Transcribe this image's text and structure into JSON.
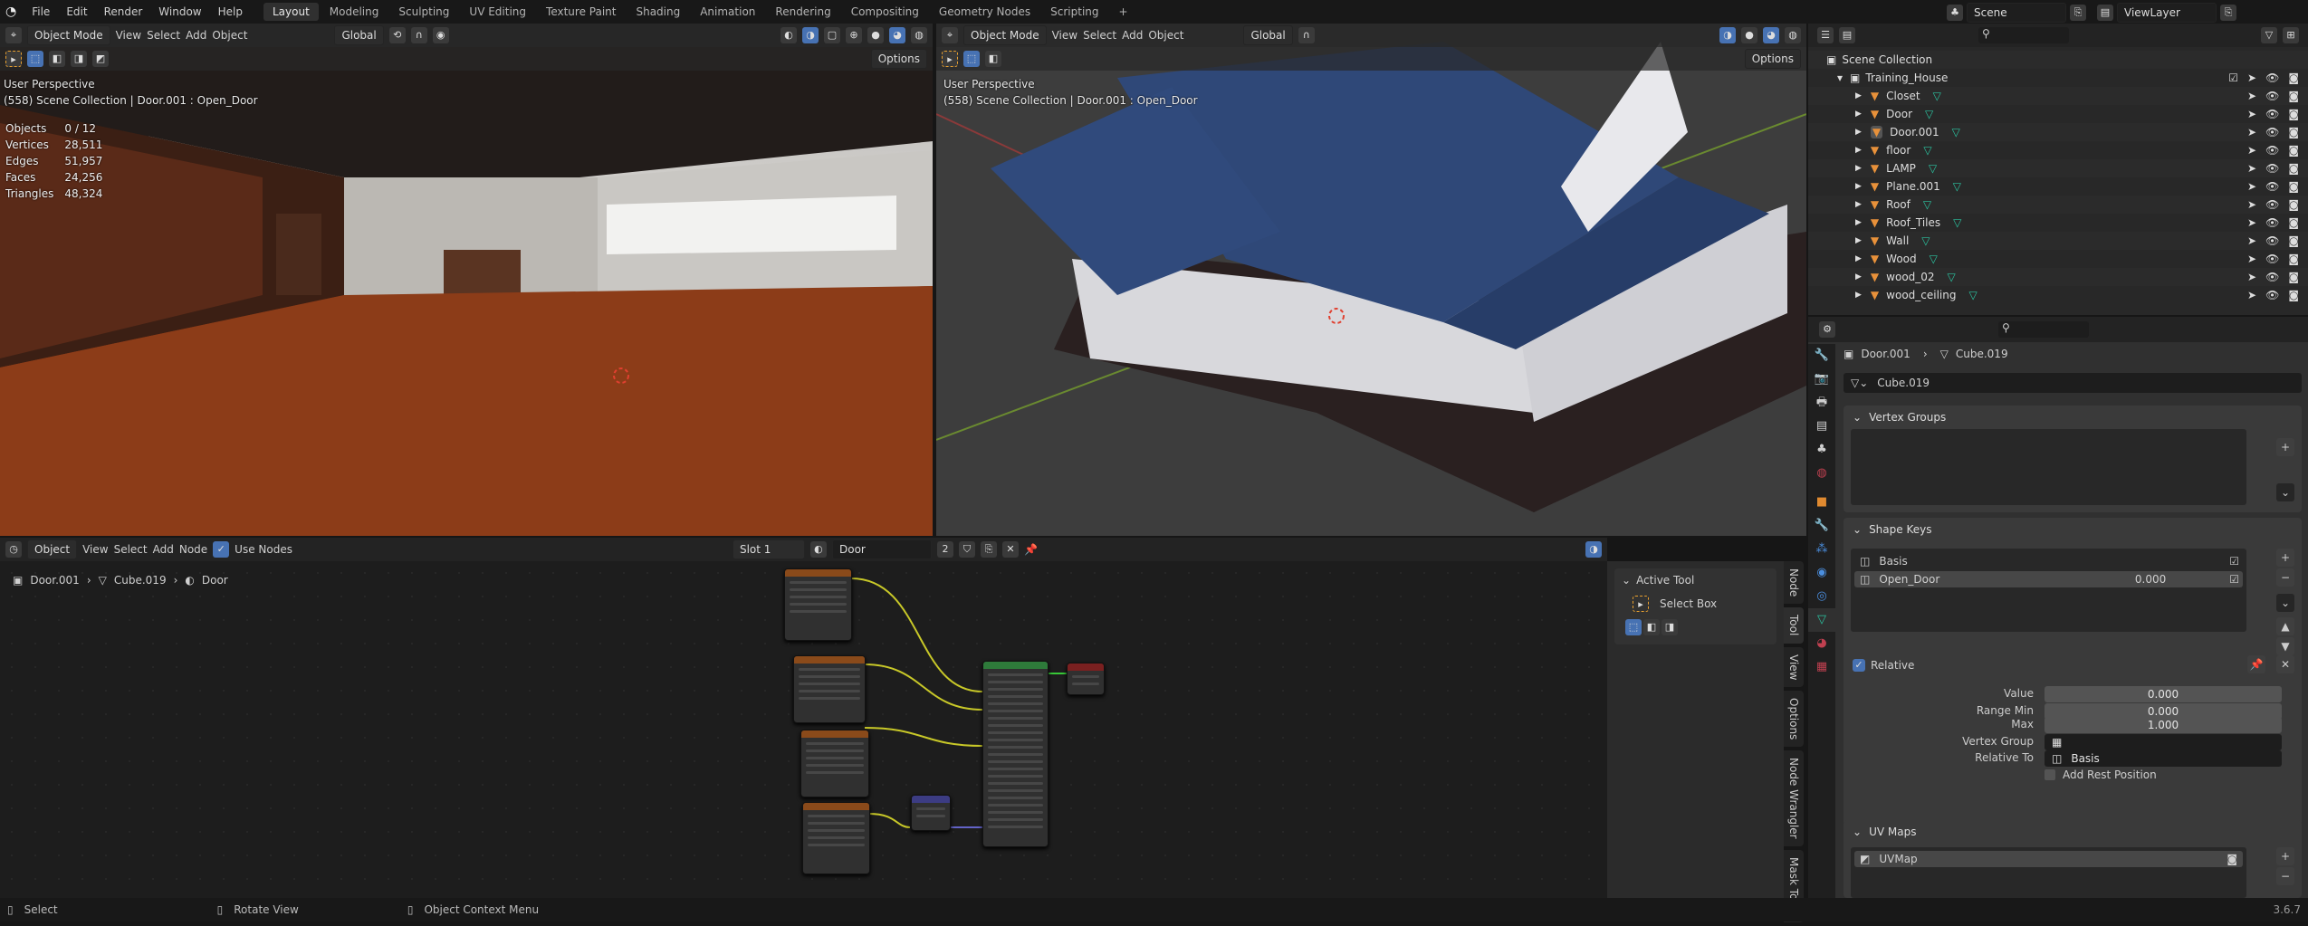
{
  "topbar": {
    "menu": [
      "File",
      "Edit",
      "Render",
      "Window",
      "Help"
    ],
    "workspaces": [
      "Layout",
      "Modeling",
      "Sculpting",
      "UV Editing",
      "Texture Paint",
      "Shading",
      "Animation",
      "Rendering",
      "Compositing",
      "Geometry Nodes",
      "Scripting"
    ],
    "active_workspace": "Layout",
    "add_tab": "+",
    "scene": "Scene",
    "view_layer": "ViewLayer"
  },
  "viewport_header": {
    "mode": "Object Mode",
    "menus": [
      "View",
      "Select",
      "Add",
      "Object"
    ],
    "transform": "Global",
    "options": "Options"
  },
  "viewport_left": {
    "perspective": "User Perspective",
    "info": "(558) Scene Collection | Door.001 : Open_Door",
    "stats": [
      {
        "label": "Objects",
        "value": "0 / 12"
      },
      {
        "label": "Vertices",
        "value": "28,511"
      },
      {
        "label": "Edges",
        "value": "51,957"
      },
      {
        "label": "Faces",
        "value": "24,256"
      },
      {
        "label": "Triangles",
        "value": "48,324"
      }
    ]
  },
  "viewport_right": {
    "perspective": "User Perspective",
    "info": "(558) Scene Collection | Door.001 : Open_Door"
  },
  "node_editor": {
    "type": "Object",
    "menus": [
      "View",
      "Select",
      "Add",
      "Node"
    ],
    "use_nodes": "Use Nodes",
    "slot": "Slot 1",
    "material": "Door",
    "users": "2",
    "breadcrumb": [
      "Door.001",
      "Cube.019",
      "Door"
    ],
    "sidebar": {
      "panel": "Active Tool",
      "tool": "Select Box",
      "tabs": [
        "Node",
        "Tool",
        "View",
        "Options",
        "Node Wrangler",
        "Mask Tools"
      ],
      "active_tab": "Tool"
    }
  },
  "outliner": {
    "root": "Scene Collection",
    "collection": "Training_House",
    "items": [
      "Closet",
      "Door",
      "Door.001",
      "floor",
      "LAMP",
      "Plane.001",
      "Roof",
      "Roof_Tiles",
      "Wall",
      "Wood",
      "wood_02",
      "wood_ceiling"
    ],
    "active_item": "Door.001"
  },
  "properties": {
    "breadcrumb": [
      "Door.001",
      "Cube.019"
    ],
    "mesh_name": "Cube.019",
    "vertex_groups": "Vertex Groups",
    "shape_keys": {
      "title": "Shape Keys",
      "keys": [
        {
          "name": "Basis",
          "value": ""
        },
        {
          "name": "Open_Door",
          "value": "0.000"
        }
      ],
      "relative": "Relative",
      "fields": [
        {
          "label": "Value",
          "value": "0.000"
        },
        {
          "label": "Range Min",
          "value": "0.000"
        },
        {
          "label": "Max",
          "value": "1.000"
        }
      ],
      "vertex_group_label": "Vertex Group",
      "relative_to_label": "Relative To",
      "relative_to": "Basis",
      "add_rest_position": "Add Rest Position"
    },
    "uv_maps": {
      "title": "UV Maps",
      "items": [
        "UVMap"
      ]
    }
  },
  "statusbar": {
    "items": [
      "Select",
      "Rotate View",
      "Object Context Menu"
    ],
    "version": "3.6.7"
  }
}
